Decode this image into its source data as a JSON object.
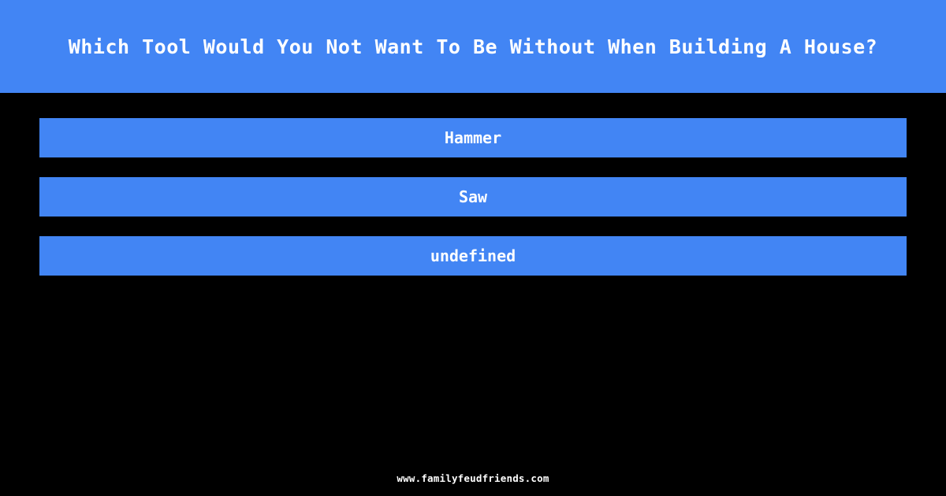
{
  "colors": {
    "background": "#000000",
    "accent_blue": "#4285f4",
    "text_white": "#ffffff"
  },
  "header": {
    "title": "Which Tool Would You Not Want To Be Without When Building A House?"
  },
  "answers": [
    {
      "label": "Hammer"
    },
    {
      "label": "Saw"
    },
    {
      "label": "undefined"
    }
  ],
  "footer": {
    "url": "www.familyfeudfriends.com"
  }
}
